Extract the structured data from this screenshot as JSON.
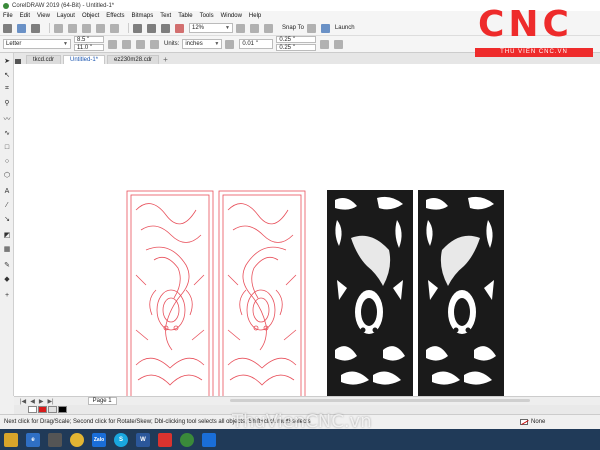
{
  "window": {
    "title": "CorelDRAW 2019 (64-Bit) - Untitled-1*"
  },
  "menu": [
    "File",
    "Edit",
    "View",
    "Layout",
    "Object",
    "Effects",
    "Bitmaps",
    "Text",
    "Table",
    "Tools",
    "Window",
    "Help"
  ],
  "toolbar": {
    "zoom": "12%",
    "snap_to": "Snap To",
    "launch": "Launch"
  },
  "propertybar": {
    "page_size": "Letter",
    "width": "8.5 \"",
    "height": "11.0 \"",
    "units_label": "Units:",
    "units": "inches",
    "nudge": "0.01 \"",
    "dup_x": "0.25 \"",
    "dup_y": "0.25 \""
  },
  "tabs": [
    {
      "label": "tkcd.cdr",
      "active": false
    },
    {
      "label": "Untitled-1*",
      "active": true
    },
    {
      "label": "ez230m28.cdr",
      "active": false
    }
  ],
  "pagebar": {
    "page_label": "Page 1"
  },
  "statusbar": {
    "hint": "Next click for Drag/Scale; Second click for Rotate/Skew; Dbl-clicking tool selects all objects; Shift+click multi-selects",
    "fill": "None"
  },
  "logo": {
    "brand": "CNC",
    "subtitle": "THU VIEN CNC.VN"
  },
  "watermark": "ThuVienCNC.vn",
  "colors": {
    "outline_panel": "#e8505b",
    "filled_panel": "#1a1a1a",
    "logo_red": "#ee2b2b",
    "taskbar": "#203a58"
  },
  "palette": [
    "#ffffff",
    "#d81b1b",
    "#e0e0e0",
    "#000000"
  ],
  "taskbar_apps": [
    {
      "name": "file-explorer-icon",
      "color": "#d9a52a",
      "label": ""
    },
    {
      "name": "edge-icon",
      "color": "#2f6fc4",
      "label": "e"
    },
    {
      "name": "store-icon",
      "color": "#555555",
      "label": ""
    },
    {
      "name": "chrome-icon",
      "color": "#e2b533",
      "label": ""
    },
    {
      "name": "zalo-icon",
      "color": "#1a6ed8",
      "label": "Zalo"
    },
    {
      "name": "skype-icon",
      "color": "#19a7e0",
      "label": "S"
    },
    {
      "name": "word-icon",
      "color": "#2b579a",
      "label": "W"
    },
    {
      "name": "foxit-icon",
      "color": "#d9332f",
      "label": ""
    },
    {
      "name": "coreldraw-icon",
      "color": "#3a8a3a",
      "label": ""
    },
    {
      "name": "teamviewer-icon",
      "color": "#1a6ed8",
      "label": ""
    }
  ]
}
